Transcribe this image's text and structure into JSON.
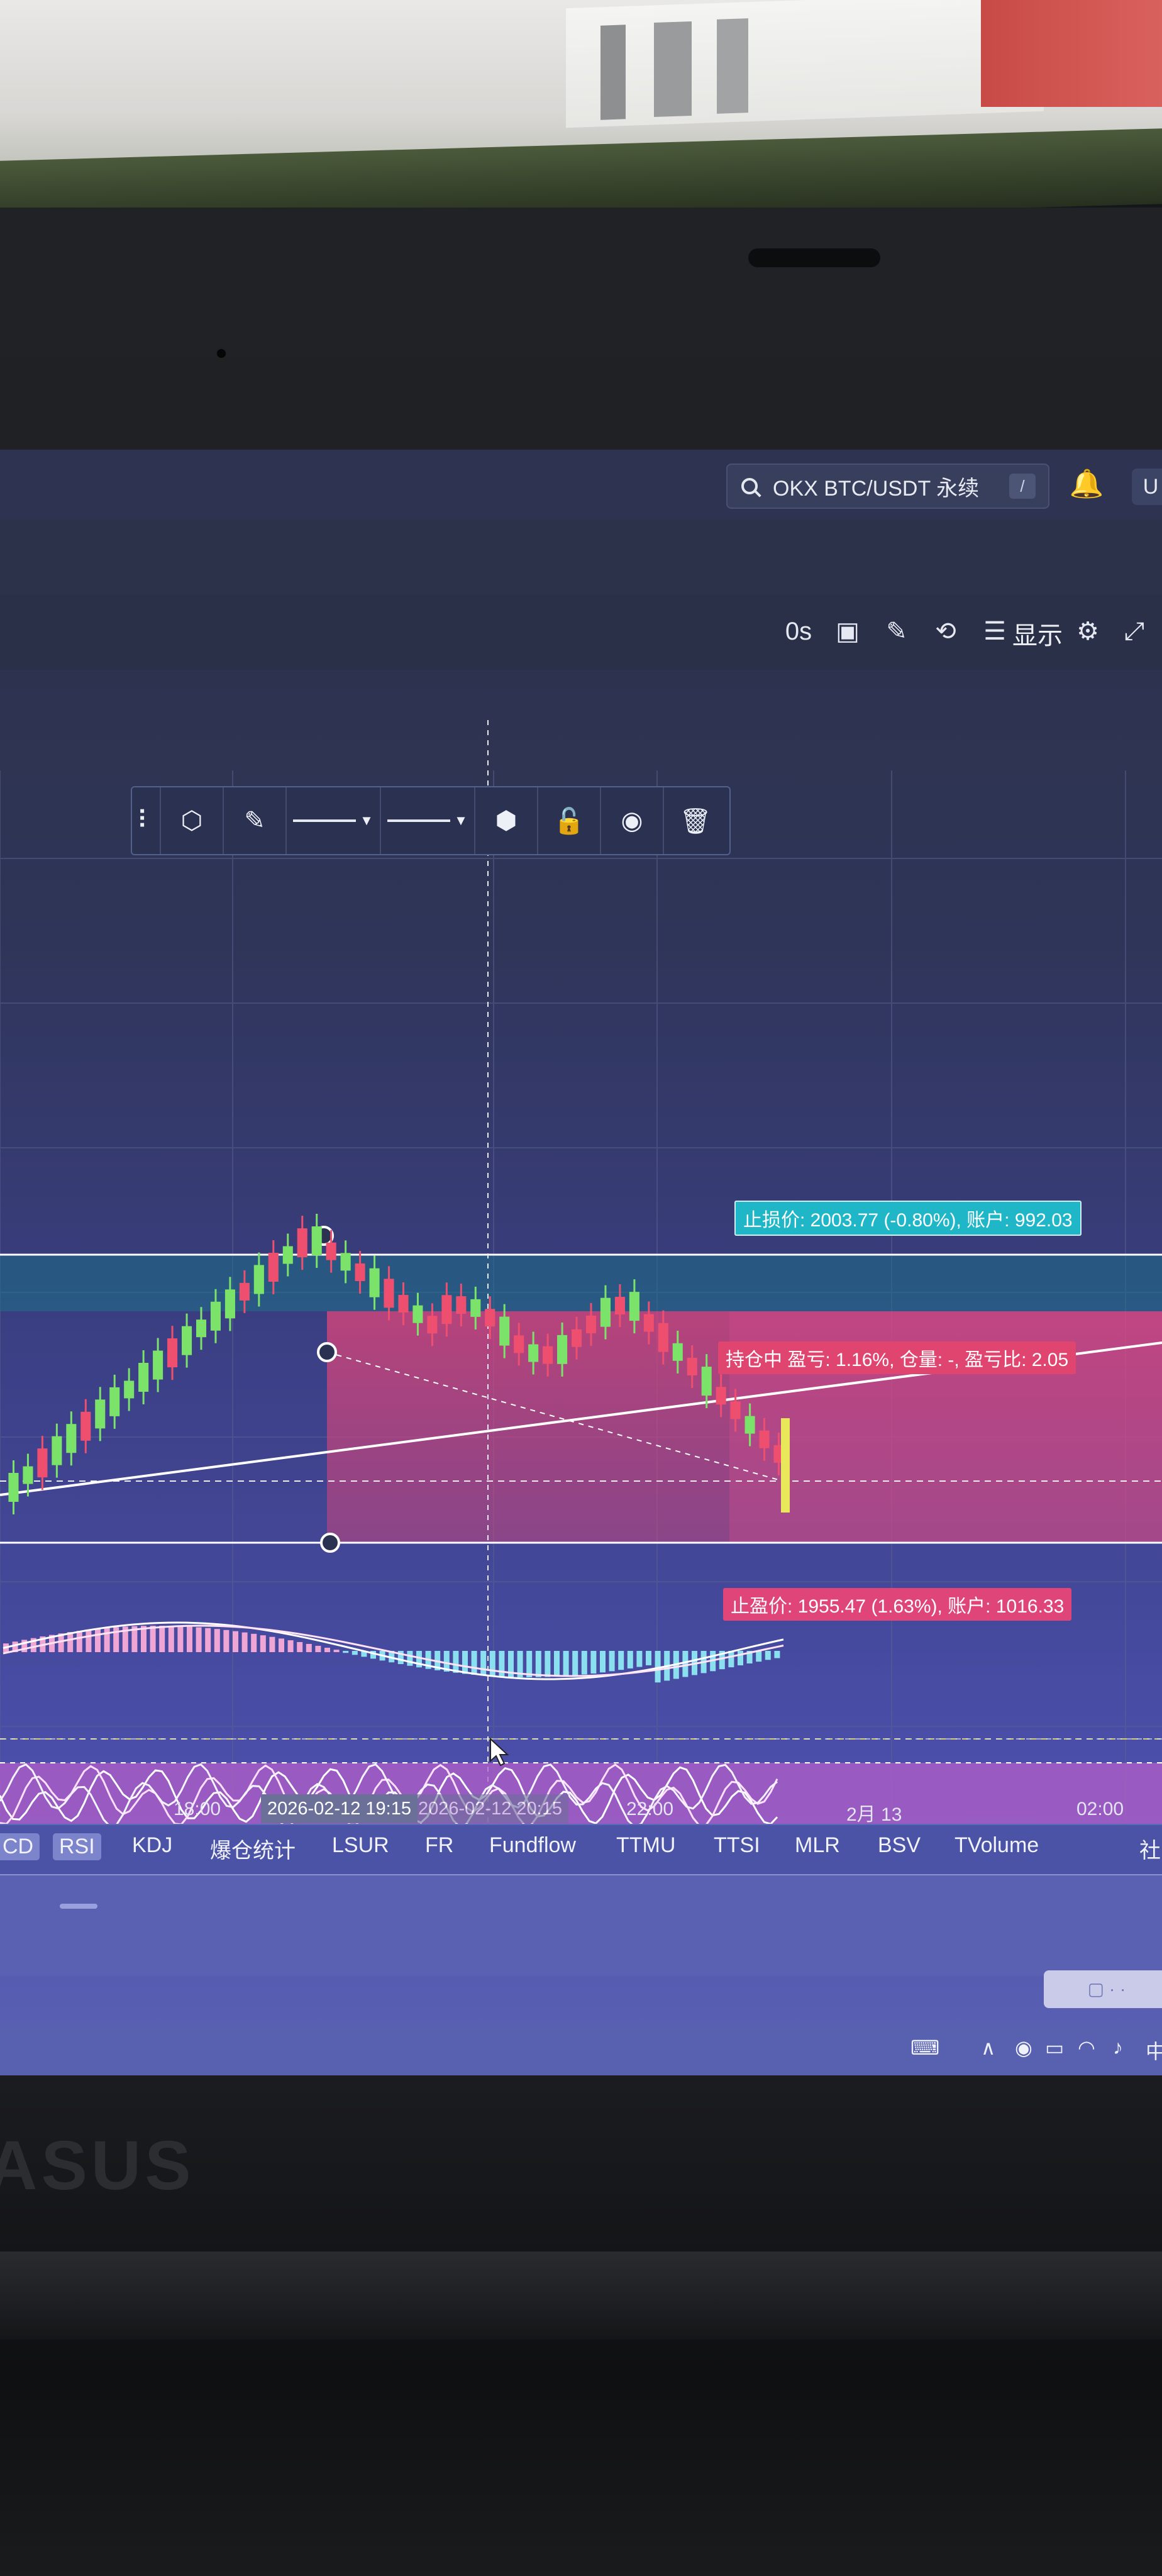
{
  "app": {
    "symbol": "OKX BTC/USDT 永续",
    "search_shortcut": "/",
    "user_button": "U"
  },
  "toolbar": {
    "timer": "0s",
    "display_label": "显示",
    "icons": [
      "clock-icon",
      "camera-icon",
      "pencil-icon",
      "alert-icon",
      "list-icon",
      "gear-icon",
      "fullscreen-icon"
    ]
  },
  "drawing_toolbar": {
    "icons": [
      "drag-handle-icon",
      "template-icon",
      "pencil-icon",
      "line-style-icon",
      "line-width-icon",
      "settings-icon",
      "lock-icon",
      "eye-icon",
      "trash-icon"
    ]
  },
  "labels": {
    "stop_loss": "止损价: 2003.77 (-0.80%), 账户: 992.03",
    "position": "持仓中 盈亏: 1.16%, 仓量: -, 盈亏比: 2.05",
    "take_profit": "止盈价: 1955.47 (1.63%), 账户: 1016.33"
  },
  "time_axis": {
    "labels": [
      "18:00",
      "22:00",
      "2月 13",
      "02:00"
    ],
    "highlight_start": "2026-02-12 19:15",
    "highlight_end": "2026-02-12 20:15"
  },
  "indicator_tabs": {
    "items": [
      "CD",
      "RSI",
      "KDJ",
      "爆仓统计",
      "LSUR",
      "FR",
      "Fundflow",
      "TTMU",
      "TTSI",
      "MLR",
      "BSV",
      "TVolume"
    ],
    "active": "RSI",
    "edge_label": "社"
  },
  "colors": {
    "bull": "#7be36a",
    "bear": "#ef4f6f",
    "long_zone": "#e04a86",
    "stop_tag": "#1fb7c7",
    "rsi_band": "#b35fc9"
  },
  "chart_data": {
    "type": "candlestick",
    "candles": [
      [
        1,
        1
      ],
      [
        1,
        0
      ],
      [
        0,
        1
      ],
      [
        1,
        1
      ],
      [
        1,
        1
      ],
      [
        0,
        1
      ],
      [
        1,
        1
      ],
      [
        1,
        1
      ],
      [
        1,
        0
      ],
      [
        1,
        1
      ],
      [
        1,
        1
      ],
      [
        0,
        1
      ],
      [
        1,
        1
      ],
      [
        1,
        0
      ],
      [
        1,
        1
      ],
      [
        1,
        1
      ],
      [
        0,
        0
      ],
      [
        1,
        1
      ],
      [
        0,
        1
      ],
      [
        1,
        0
      ],
      [
        0,
        1
      ],
      [
        1,
        1
      ],
      [
        0,
        0
      ],
      [
        1,
        0
      ],
      [
        0,
        0
      ],
      [
        1,
        1
      ],
      [
        0,
        1
      ],
      [
        0,
        0
      ],
      [
        1,
        0
      ],
      [
        0,
        0
      ],
      [
        0,
        1
      ],
      [
        0,
        0
      ],
      [
        1,
        0
      ],
      [
        0,
        0
      ],
      [
        1,
        1
      ],
      [
        0,
        0
      ],
      [
        1,
        0
      ],
      [
        0,
        0
      ],
      [
        1,
        1
      ],
      [
        0,
        0
      ],
      [
        0,
        0
      ],
      [
        1,
        1
      ],
      [
        0,
        0
      ],
      [
        1,
        1
      ],
      [
        0,
        0
      ],
      [
        0,
        1
      ],
      [
        1,
        0
      ],
      [
        0,
        0
      ],
      [
        1,
        1
      ],
      [
        0,
        0
      ],
      [
        0,
        0
      ],
      [
        1,
        0
      ],
      [
        0,
        0
      ],
      [
        0,
        0
      ]
    ]
  }
}
